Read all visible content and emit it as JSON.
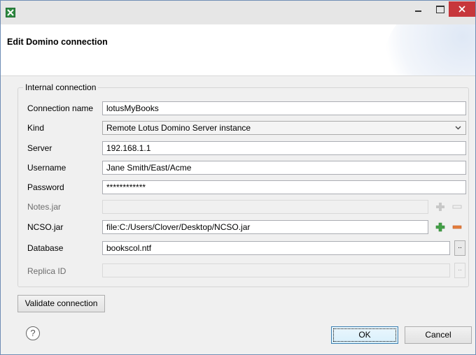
{
  "window": {
    "title": "",
    "header_title": "Edit Domino connection"
  },
  "group": {
    "legend": "Internal connection"
  },
  "fields": {
    "connection_name": {
      "label": "Connection name",
      "value": "lotusMyBooks"
    },
    "kind": {
      "label": "Kind",
      "value": "Remote Lotus Domino Server instance"
    },
    "server": {
      "label": "Server",
      "value": "192.168.1.1"
    },
    "username": {
      "label": "Username",
      "value": "Jane Smith/East/Acme"
    },
    "password": {
      "label": "Password",
      "value": "************"
    },
    "notes_jar": {
      "label": "Notes.jar",
      "value": ""
    },
    "ncso_jar": {
      "label": "NCSO.jar",
      "value": "file:C:/Users/Clover/Desktop/NCSO.jar"
    },
    "database": {
      "label": "Database",
      "value": "bookscol.ntf"
    },
    "replica_id": {
      "label": "Replica ID",
      "value": ""
    }
  },
  "buttons": {
    "browse": "..",
    "validate": "Validate connection",
    "ok": "OK",
    "cancel": "Cancel",
    "help": "?"
  },
  "icons": {
    "app": "app-logo-icon",
    "add": "plus-icon",
    "remove": "minus-icon",
    "dropdown": "chevron-down-icon"
  },
  "colors": {
    "close_button": "#c7373c",
    "add_icon": "#43a047",
    "remove_icon": "#e57e3c"
  }
}
